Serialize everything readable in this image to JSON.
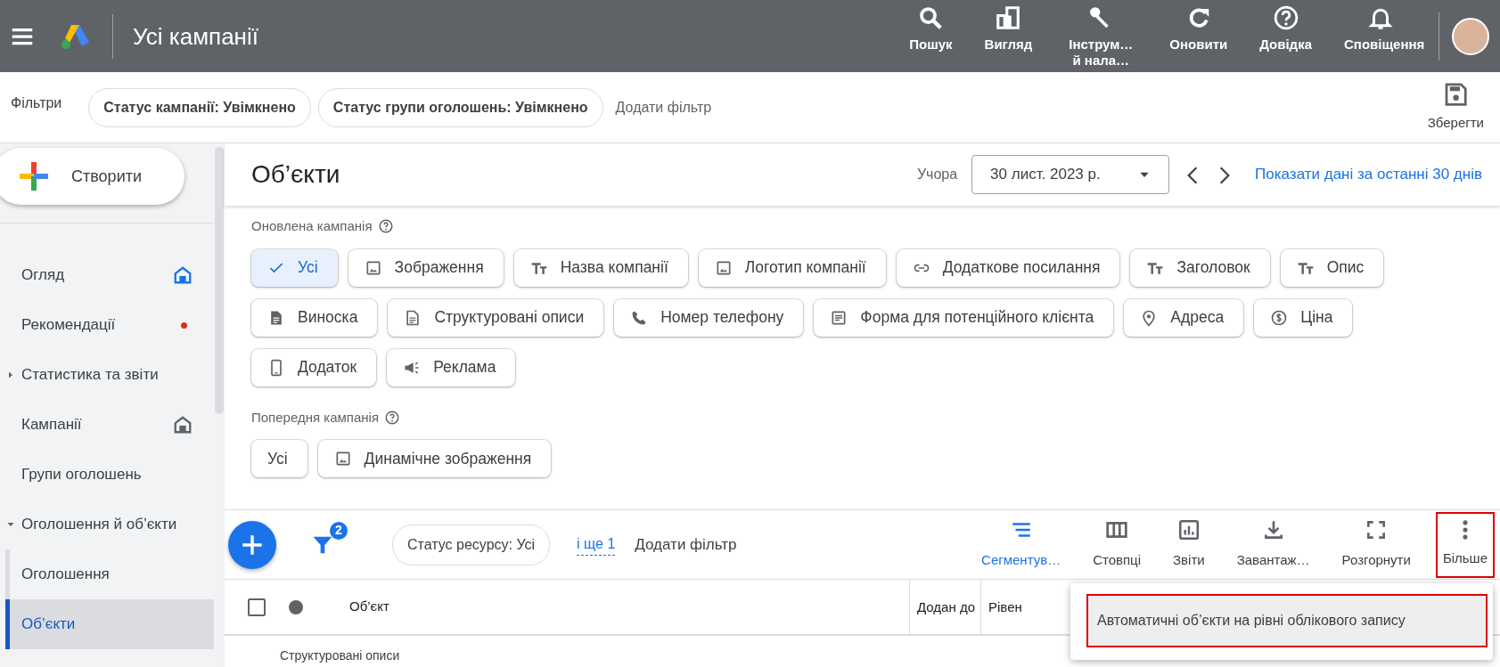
{
  "app_bar": {
    "title": "Усі кампанії",
    "actions": [
      {
        "label": "Пошук",
        "kind": "search"
      },
      {
        "label": "Вигляд",
        "kind": "view"
      },
      {
        "label": "Інструм… й нала…",
        "kind": "tools"
      },
      {
        "label": "Оновити",
        "kind": "refresh"
      },
      {
        "label": "Довідка",
        "kind": "help"
      },
      {
        "label": "Сповіщення",
        "kind": "bell"
      }
    ]
  },
  "filters_bar": {
    "label": "Фільтри",
    "chips": [
      "Статус кампанії: Увімкнено",
      "Статус групи оголошень: Увімкнено"
    ],
    "add_filter": "Додати фільтр",
    "save": "Зберегти"
  },
  "sidebar": {
    "create": "Створити",
    "items": [
      {
        "label": "Огляд",
        "selected": false,
        "kind": "home_pinned"
      },
      {
        "label": "Рекомендації",
        "selected": false,
        "kind": "dot"
      },
      {
        "label": "Статистика та звіти",
        "selected": false,
        "expanded": false
      },
      {
        "label": "Кампанії",
        "selected": false,
        "kind": "home"
      },
      {
        "label": "Групи оголошень",
        "selected": false
      },
      {
        "label": "Оголошення й об’єкти",
        "selected": false,
        "expanded": true,
        "children": [
          {
            "label": "Оголошення",
            "selected": false
          },
          {
            "label": "Об’єкти",
            "selected": true
          }
        ]
      }
    ]
  },
  "page": {
    "title": "Об’єкти",
    "date_label": "Учора",
    "date": "30 лист. 2023 р.",
    "show_link": "Показати дані за останні 30 днів"
  },
  "sections": [
    {
      "title": "Оновлена кампанія",
      "chips": [
        {
          "label": "Усі",
          "kind": "all",
          "selected": true
        },
        {
          "label": "Зображення",
          "kind": "image",
          "selected": false
        },
        {
          "label": "Назва компанії",
          "kind": "text",
          "selected": false
        },
        {
          "label": "Логотип компанії",
          "kind": "image",
          "selected": false
        },
        {
          "label": "Додаткове посилання",
          "kind": "link",
          "selected": false
        },
        {
          "label": "Заголовок",
          "kind": "text",
          "selected": false
        },
        {
          "label": "Опис",
          "kind": "text",
          "selected": false
        },
        {
          "label": "Виноска",
          "kind": "doc",
          "selected": false
        },
        {
          "label": "Структуровані описи",
          "kind": "doc_outline",
          "selected": false
        },
        {
          "label": "Номер телефону",
          "kind": "phone",
          "selected": false
        },
        {
          "label": "Форма для потенційного клієнта",
          "kind": "form",
          "selected": false
        },
        {
          "label": "Адреса",
          "kind": "pin",
          "selected": false
        },
        {
          "label": "Ціна",
          "kind": "price",
          "selected": false
        },
        {
          "label": "Додаток",
          "kind": "mobile",
          "selected": false
        },
        {
          "label": "Реклама",
          "kind": "megaphone",
          "selected": false
        }
      ]
    },
    {
      "title": "Попередня кампанія",
      "chips": [
        {
          "label": "Усі",
          "kind": "all",
          "selected": false
        },
        {
          "label": "Динамічне зображення",
          "kind": "image",
          "selected": false
        }
      ]
    }
  ],
  "toolbar": {
    "filter_count": "2",
    "filter_chip": "Статус ресурсу: Усі",
    "more_filters": "і ще 1",
    "add_filter": "Додати фільтр",
    "actions": [
      {
        "label": "Сегментув…",
        "kind": "segment",
        "active": true,
        "highlighted": false
      },
      {
        "label": "Стовпці",
        "kind": "columns",
        "active": false,
        "highlighted": false
      },
      {
        "label": "Звіти",
        "kind": "reports",
        "active": false,
        "highlighted": false
      },
      {
        "label": "Завантаж…",
        "kind": "download",
        "active": false,
        "highlighted": false
      },
      {
        "label": "Розгорнути",
        "kind": "expand",
        "active": false,
        "highlighted": false
      },
      {
        "label": "Більше",
        "kind": "more",
        "active": false,
        "highlighted": true
      }
    ]
  },
  "table": {
    "select_all_checked": false,
    "columns": [
      "Об’єкт",
      "Додан до",
      "Рівен"
    ],
    "rows": [
      {
        "column_1": "Структуровані описи"
      }
    ]
  },
  "menu": {
    "items": [
      {
        "label": "Автоматичні об’єкти на рівні облікового запису",
        "highlighted": true
      }
    ]
  }
}
